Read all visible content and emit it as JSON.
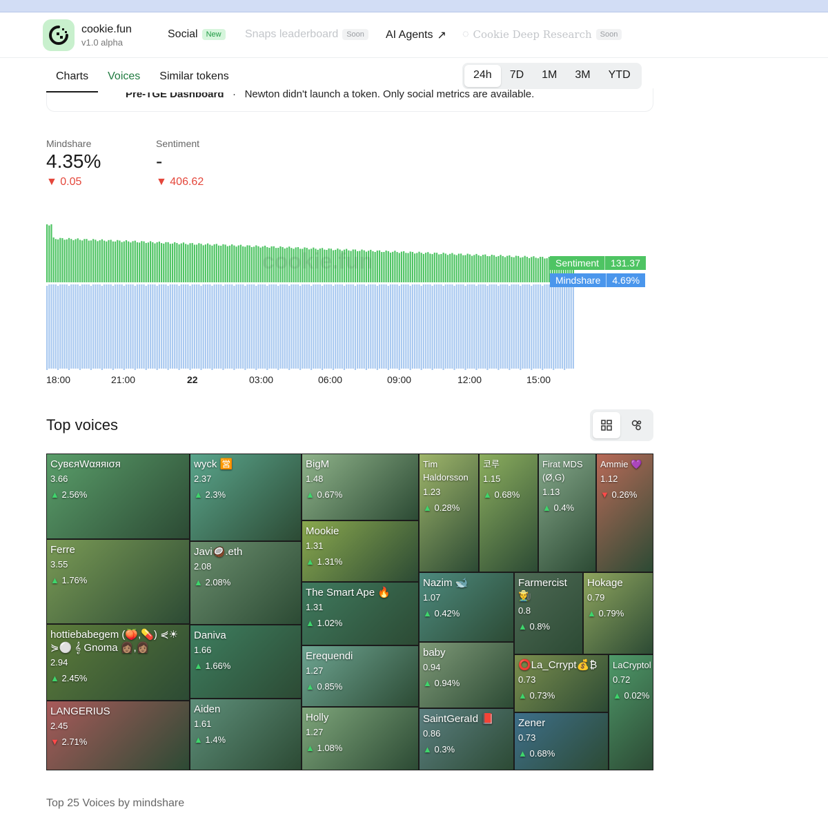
{
  "app": {
    "name": "cookie.fun",
    "version": "v1.0 alpha"
  },
  "nav": [
    {
      "label": "Social",
      "badge": "New"
    },
    {
      "label": "Snaps leaderboard",
      "badge": "Soon"
    },
    {
      "label": "AI Agents",
      "icon": "external-arrow-icon"
    },
    {
      "label": "Cookie Deep Research",
      "badge": "Soon"
    }
  ],
  "tabs": [
    "Charts",
    "Voices",
    "Similar tokens"
  ],
  "ranges": [
    "24h",
    "7D",
    "1M",
    "3M",
    "YTD"
  ],
  "banner": {
    "bold": "Pre-TGE Dashboard",
    "sep": "·",
    "text": "Newton didn't launch a token. Only social metrics are available."
  },
  "metrics": {
    "mindshare": {
      "label": "Mindshare",
      "value": "4.35%",
      "delta": "▼ 0.05"
    },
    "sentiment": {
      "label": "Sentiment",
      "value": "-",
      "delta": "▼ 406.62"
    }
  },
  "chart_tags": {
    "sentiment": {
      "label": "Sentiment",
      "value": "131.37"
    },
    "mindshare": {
      "label": "Mindshare",
      "value": "4.69%"
    }
  },
  "chart_data": {
    "type": "bar",
    "x_ticks": [
      "18:00",
      "21:00",
      "22",
      "03:00",
      "06:00",
      "09:00",
      "12:00",
      "15:00"
    ],
    "series": [
      {
        "name": "Sentiment",
        "color": "#4ec463"
      },
      {
        "name": "Mindshare",
        "color": "#a9c9f0"
      }
    ]
  },
  "watermark": "cookie.fun",
  "top_voices": {
    "title": "Top voices",
    "footer": "Top 25 Voices by mindshare",
    "cells": [
      {
        "name": "СувєяWαяяισя",
        "val": "3.66",
        "chg": "2.56%",
        "dir": "up",
        "color": "#5a9e6a"
      },
      {
        "name": "Ferre",
        "val": "3.55",
        "chg": "1.76%",
        "dir": "up",
        "color": "#7a9a55"
      },
      {
        "name": "hottiebabegem (🍑,💊) ⋞☀⋟⚪ 𝄞 Gnoma 👩🏽‍,👩🏽‍",
        "val": "2.94",
        "chg": "2.45%",
        "dir": "up",
        "color": "#5d7c3a"
      },
      {
        "name": "LANGERIUS",
        "val": "2.45",
        "chg": "2.71%",
        "dir": "down",
        "color": "#a85a5a"
      },
      {
        "name": "wyck 🈺",
        "val": "2.37",
        "chg": "2.3%",
        "dir": "up",
        "color": "#5aa58c"
      },
      {
        "name": "Javi🥥.eth",
        "val": "2.08",
        "chg": "2.08%",
        "dir": "up",
        "color": "#6b8f6e"
      },
      {
        "name": "Daniva",
        "val": "1.66",
        "chg": "1.66%",
        "dir": "up",
        "color": "#3e7f60"
      },
      {
        "name": "Aiden",
        "val": "1.61",
        "chg": "1.4%",
        "dir": "up",
        "color": "#5e8f7a"
      },
      {
        "name": "BigM",
        "val": "1.48",
        "chg": "0.67%",
        "dir": "up",
        "color": "#8fb38a"
      },
      {
        "name": "Mookie",
        "val": "1.31",
        "chg": "1.31%",
        "dir": "up",
        "color": "#8aa84e"
      },
      {
        "name": "The Smart Ape 🔥",
        "val": "1.31",
        "chg": "1.02%",
        "dir": "up",
        "color": "#3f7a5e"
      },
      {
        "name": "Erequendi",
        "val": "1.27",
        "chg": "0.85%",
        "dir": "up",
        "color": "#6ea592"
      },
      {
        "name": "Holly",
        "val": "1.27",
        "chg": "1.08%",
        "dir": "up",
        "color": "#7ea57a"
      },
      {
        "name": "Tim Haldorsson",
        "val": "1.23",
        "chg": "0.28%",
        "dir": "up",
        "color": "#9fb56a"
      },
      {
        "name": "Nazim 🐋",
        "val": "1.07",
        "chg": "0.42%",
        "dir": "up",
        "color": "#4d8a7e"
      },
      {
        "name": "baby",
        "val": "0.94",
        "chg": "0.94%",
        "dir": "up",
        "color": "#7f9a78"
      },
      {
        "name": "SaintGeraId 📕",
        "val": "0.86",
        "chg": "0.3%",
        "dir": "up",
        "color": "#5b7f80"
      },
      {
        "name": "코루",
        "val": "1.15",
        "chg": "0.68%",
        "dir": "up",
        "color": "#8cae5e"
      },
      {
        "name": "Farmercist 👨‍🌾",
        "val": "0.8",
        "chg": "0.8%",
        "dir": "up",
        "color": "#4e6a55"
      },
      {
        "name": "⭕La_Crrypt💰₿",
        "val": "0.73",
        "chg": "0.73%",
        "dir": "up",
        "color": "#7c8f4e"
      },
      {
        "name": "Zener",
        "val": "0.73",
        "chg": "0.68%",
        "dir": "up",
        "color": "#3e6f8a"
      },
      {
        "name": "Firat MDS (Ø,G)",
        "val": "1.13",
        "chg": "0.4%",
        "dir": "up",
        "color": "#85a88a"
      },
      {
        "name": "Hokage",
        "val": "0.79",
        "chg": "0.79%",
        "dir": "up",
        "color": "#8fa55e"
      },
      {
        "name": "LaCryptol",
        "val": "0.72",
        "chg": "0.02%",
        "dir": "up",
        "color": "#4f9a6a"
      },
      {
        "name": "Ammie 💜",
        "val": "1.12",
        "chg": "0.26%",
        "dir": "down",
        "color": "#b86a58"
      }
    ]
  }
}
